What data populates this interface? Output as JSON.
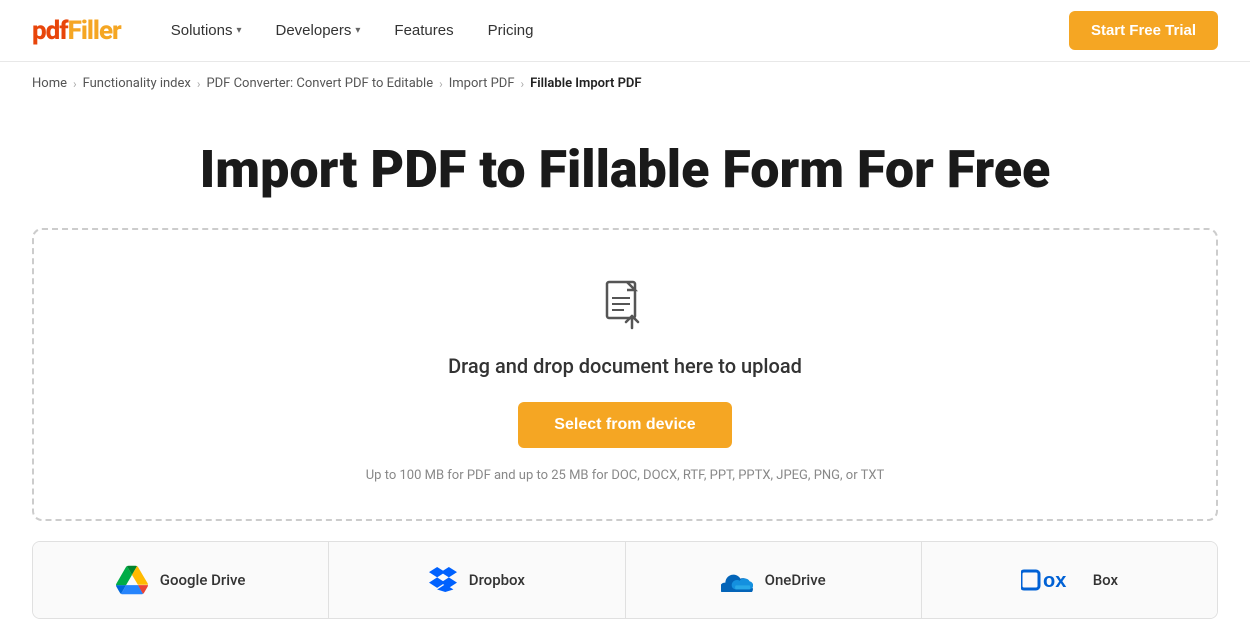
{
  "logo": {
    "pdf": "pdf",
    "filler": "Filler"
  },
  "nav": {
    "items": [
      {
        "label": "Solutions",
        "hasDropdown": true
      },
      {
        "label": "Developers",
        "hasDropdown": true
      },
      {
        "label": "Features",
        "hasDropdown": false
      },
      {
        "label": "Pricing",
        "hasDropdown": false
      }
    ],
    "cta": "Start Free Trial"
  },
  "breadcrumb": {
    "items": [
      {
        "label": "Home",
        "link": true
      },
      {
        "label": "Functionality index",
        "link": true
      },
      {
        "label": "PDF Converter: Convert PDF to Editable",
        "link": true
      },
      {
        "label": "Import PDF",
        "link": true
      },
      {
        "label": "Fillable Import PDF",
        "link": false
      }
    ]
  },
  "hero": {
    "title": "Import PDF to Fillable Form For Free"
  },
  "upload": {
    "drag_text": "Drag and drop document here to upload",
    "select_btn": "Select from device",
    "hint": "Up to 100 MB for PDF and up to 25 MB for DOC, DOCX, RTF, PPT, PPTX, JPEG, PNG, or TXT"
  },
  "cloud_services": [
    {
      "id": "google-drive",
      "label": "Google Drive"
    },
    {
      "id": "dropbox",
      "label": "Dropbox"
    },
    {
      "id": "onedrive",
      "label": "OneDrive"
    },
    {
      "id": "box",
      "label": "Box"
    }
  ]
}
